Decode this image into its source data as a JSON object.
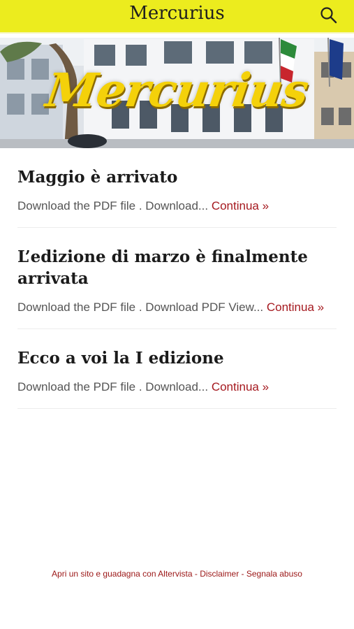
{
  "header": {
    "site_title": "Mercurius",
    "search_icon": "search-icon"
  },
  "banner": {
    "logo_text": "Mercurius"
  },
  "posts": [
    {
      "title": "Maggio è arrivato",
      "excerpt": "Download the PDF file . Download...",
      "continue_label": "Continua »"
    },
    {
      "title": "L’edizione di marzo è finalmente arrivata",
      "excerpt": "Download the PDF file . Download PDF View...",
      "continue_label": "Continua »"
    },
    {
      "title": "Ecco a voi la I edizione",
      "excerpt": "Download the PDF file . Download...",
      "continue_label": "Continua »"
    }
  ],
  "footer": {
    "altervista_link": "Apri un sito e guadagna con Altervista",
    "sep1": " - ",
    "disclaimer_link": "Disclaimer",
    "sep2": " - ",
    "report_link": "Segnala abuso"
  },
  "colors": {
    "header_bg": "#ecec1e",
    "link": "#a5191f",
    "logo_yellow": "#f4d10a"
  }
}
